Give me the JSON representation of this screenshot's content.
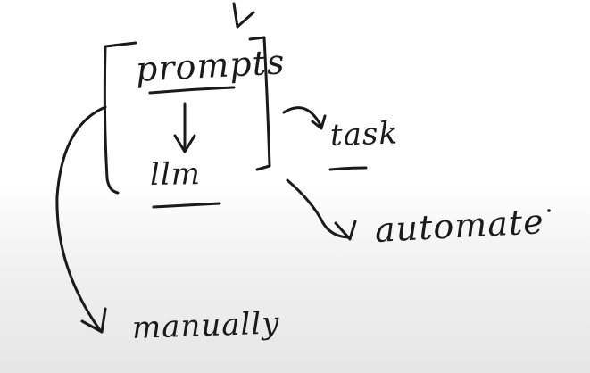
{
  "colors": {
    "ink": "#1a1a1a",
    "background_top": "#ffffff",
    "background_bottom": "#e6e6e6"
  },
  "diagram": {
    "nodes": {
      "prompts": "prompts",
      "llm": "llm",
      "task": "task",
      "automate": "automate",
      "manual": "manually"
    },
    "edges": [
      {
        "from": "prompts",
        "to": "llm"
      },
      {
        "from": "box",
        "to": "task"
      },
      {
        "from": "box",
        "to": "automate"
      },
      {
        "from": "box",
        "to": "manual"
      }
    ]
  }
}
